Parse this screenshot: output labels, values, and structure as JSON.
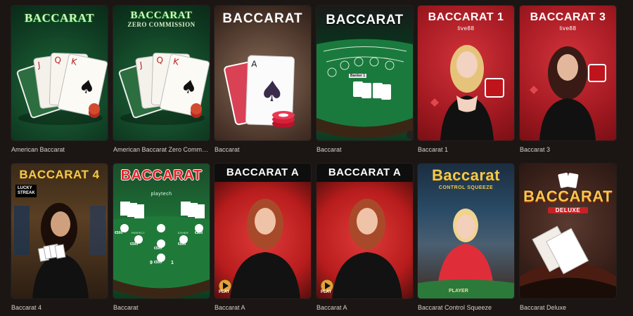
{
  "games": [
    {
      "label": "American Baccarat",
      "thumb_title": "BACCARAT",
      "theme": "green"
    },
    {
      "label": "American Baccarat Zero Commis…",
      "thumb_title": "BACCARAT",
      "thumb_sub": "ZERO COMMISSION",
      "theme": "green"
    },
    {
      "label": "Baccarat",
      "thumb_title": "BACCARAT",
      "theme": "brown"
    },
    {
      "label": "Baccarat",
      "thumb_title": "BACCARAT",
      "theme": "table"
    },
    {
      "label": "Baccarat 1",
      "thumb_title": "BACCARAT 1",
      "brand": "live88",
      "theme": "red"
    },
    {
      "label": "Baccarat 3",
      "thumb_title": "BACCARAT 3",
      "brand": "live88",
      "theme": "red"
    },
    {
      "label": "Baccarat 4",
      "thumb_title": "BACCARAT 4",
      "badge": "LUCKY STREAK",
      "theme": "casino"
    },
    {
      "label": "Baccarat",
      "thumb_title": "BACCARAT",
      "brand": "playtech",
      "theme": "green2",
      "chips": [
        "€500",
        "€500",
        "€500",
        "€500",
        "€500",
        "€500"
      ],
      "table_texts": [
        "PERFECT",
        "EITHER",
        "9",
        "1"
      ]
    },
    {
      "label": "Baccarat A",
      "thumb_title": "BACCARAT A",
      "play": "PLAY",
      "theme": "reddark"
    },
    {
      "label": "Baccarat A",
      "thumb_title": "BACCARAT A",
      "play": "PLAY",
      "theme": "reddark"
    },
    {
      "label": "Baccarat Control Squeeze",
      "thumb_title": "Baccarat",
      "thumb_sub": "CONTROL SQUEEZE",
      "table_text": "PLAYER",
      "theme": "room"
    },
    {
      "label": "Baccarat Deluxe",
      "thumb_title": "BACCARAT",
      "thumb_sub": "DELUXE",
      "theme": "deluxe"
    }
  ],
  "table_banner": "Banker 1",
  "colors": {
    "background": "#1b1614",
    "label_text": "#d6d0ca",
    "green_felt": "#146a35",
    "red_theme": "#c2242c",
    "gold": "#f2c94c"
  }
}
